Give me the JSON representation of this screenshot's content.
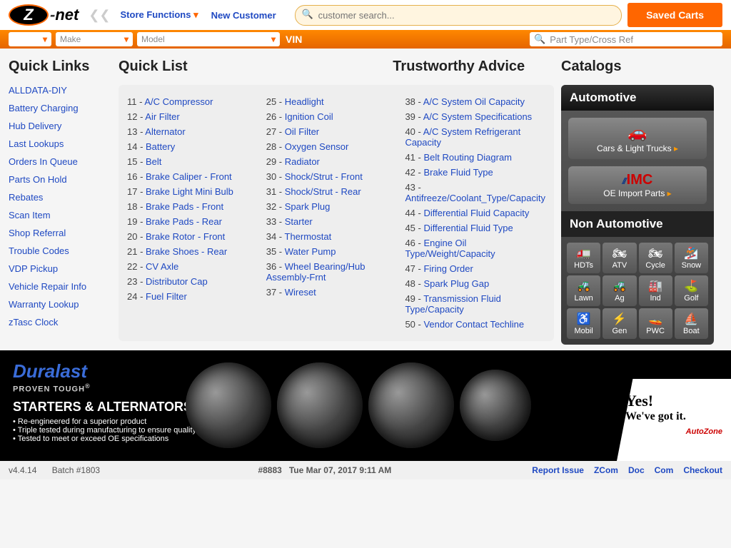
{
  "header": {
    "logo_text": "z-net",
    "store_functions": "Store Functions",
    "new_customer": "New Customer",
    "search_placeholder": "customer search...",
    "saved_carts": "Saved Carts"
  },
  "orange_bar": {
    "make": "Make",
    "model": "Model",
    "vin": "VIN",
    "part_search": "Part Type/Cross Ref"
  },
  "sections": {
    "quick_links": "Quick Links",
    "quick_list": "Quick List",
    "trustworthy": "Trustworthy Advice",
    "catalogs": "Catalogs"
  },
  "quick_links": [
    "ALLDATA-DIY",
    "Battery Charging",
    "Hub Delivery",
    "Last Lookups",
    "Orders In Queue",
    "Parts On Hold",
    "Rebates",
    "Scan Item",
    "Shop Referral",
    "Trouble Codes",
    "VDP Pickup",
    "Vehicle Repair Info",
    "Warranty Lookup",
    "zTasc Clock"
  ],
  "quick_list_col1": [
    {
      "n": "11",
      "t": "A/C Compressor"
    },
    {
      "n": "12",
      "t": "Air Filter"
    },
    {
      "n": "13",
      "t": "Alternator"
    },
    {
      "n": "14",
      "t": "Battery"
    },
    {
      "n": "15",
      "t": "Belt"
    },
    {
      "n": "16",
      "t": "Brake Caliper - Front"
    },
    {
      "n": "17",
      "t": "Brake Light Mini Bulb"
    },
    {
      "n": "18",
      "t": "Brake Pads - Front"
    },
    {
      "n": "19",
      "t": "Brake Pads - Rear"
    },
    {
      "n": "20",
      "t": "Brake Rotor - Front"
    },
    {
      "n": "21",
      "t": "Brake Shoes - Rear"
    },
    {
      "n": "22",
      "t": "CV Axle"
    },
    {
      "n": "23",
      "t": "Distributor Cap"
    },
    {
      "n": "24",
      "t": "Fuel Filter"
    }
  ],
  "quick_list_col2": [
    {
      "n": "25",
      "t": "Headlight"
    },
    {
      "n": "26",
      "t": "Ignition Coil"
    },
    {
      "n": "27",
      "t": "Oil Filter"
    },
    {
      "n": "28",
      "t": "Oxygen Sensor"
    },
    {
      "n": "29",
      "t": "Radiator"
    },
    {
      "n": "30",
      "t": "Shock/Strut - Front"
    },
    {
      "n": "31",
      "t": "Shock/Strut - Rear"
    },
    {
      "n": "32",
      "t": "Spark Plug"
    },
    {
      "n": "33",
      "t": "Starter"
    },
    {
      "n": "34",
      "t": "Thermostat"
    },
    {
      "n": "35",
      "t": "Water Pump"
    },
    {
      "n": "36",
      "t": "Wheel Bearing/Hub Assembly-Frnt"
    },
    {
      "n": "37",
      "t": "Wireset"
    }
  ],
  "trustworthy": [
    {
      "n": "38",
      "t": "A/C System Oil Capacity"
    },
    {
      "n": "39",
      "t": "A/C System Specifications"
    },
    {
      "n": "40",
      "t": "A/C System Refrigerant Capacity"
    },
    {
      "n": "41",
      "t": "Belt Routing Diagram"
    },
    {
      "n": "42",
      "t": "Brake Fluid Type"
    },
    {
      "n": "43",
      "t": "Antifreeze/Coolant_Type/Capacity"
    },
    {
      "n": "44",
      "t": "Differential Fluid Capacity"
    },
    {
      "n": "45",
      "t": "Differential Fluid Type"
    },
    {
      "n": "46",
      "t": "Engine Oil Type/Weight/Capacity"
    },
    {
      "n": "47",
      "t": "Firing Order"
    },
    {
      "n": "48",
      "t": "Spark Plug Gap"
    },
    {
      "n": "49",
      "t": "Transmission Fluid Type/Capacity"
    },
    {
      "n": "50",
      "t": "Vendor Contact Techline"
    }
  ],
  "catalogs": {
    "automotive": "Automotive",
    "cars_trucks": "Cars & Light Trucks",
    "oe_import": "OE Import Parts",
    "imc": "IMC",
    "non_automotive": "Non Automotive",
    "cells": [
      {
        "ic": "🚛",
        "t": "HDTs"
      },
      {
        "ic": "🏍",
        "t": "ATV"
      },
      {
        "ic": "🏍",
        "t": "Cycle"
      },
      {
        "ic": "🏂",
        "t": "Snow"
      },
      {
        "ic": "🚜",
        "t": "Lawn"
      },
      {
        "ic": "🚜",
        "t": "Ag"
      },
      {
        "ic": "🏭",
        "t": "Ind"
      },
      {
        "ic": "⛳",
        "t": "Golf"
      },
      {
        "ic": "♿",
        "t": "Mobil"
      },
      {
        "ic": "⚡",
        "t": "Gen"
      },
      {
        "ic": "🚤",
        "t": "PWC"
      },
      {
        "ic": "⛵",
        "t": "Boat"
      }
    ]
  },
  "banner": {
    "brand": "Duralast",
    "proven": "PROVEN TOUGH",
    "title": "STARTERS & ALTERNATORS",
    "b1": "Re-engineered for a superior product",
    "b2": "Triple tested during manufacturing to ensure quality",
    "b3": "Tested to meet or exceed OE specifications",
    "yes": "Yes!",
    "got": "We've got it.",
    "autozone": "AutoZone"
  },
  "footer": {
    "version": "v4.4.14",
    "batch": "Batch #1803",
    "session": "#8883",
    "datetime": "Tue Mar 07, 2017 9:11 AM",
    "links": [
      "Report Issue",
      "ZCom",
      "Doc",
      "Com",
      "Checkout"
    ]
  }
}
